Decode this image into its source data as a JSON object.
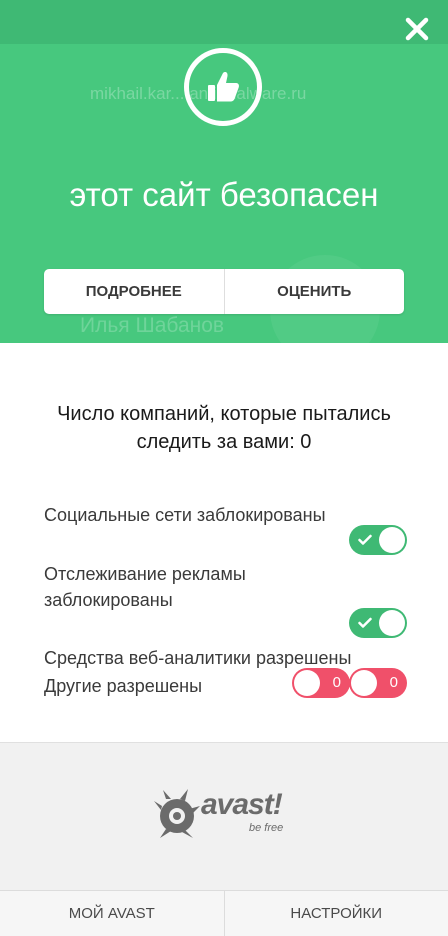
{
  "header": {
    "background_url_text": "mikhail.kar... anti-malware.ru",
    "background_name_text": "Илья Шабанов",
    "status_title": "этот сайт безопасен",
    "details_button": "ПОДРОБНЕЕ",
    "rate_button": "ОЦЕНИТЬ"
  },
  "tracking": {
    "title": "Число компаний, которые пытались следить за вами: 0",
    "items": [
      {
        "label": "Социальные сети заблокированы",
        "state": "on"
      },
      {
        "label": "Отслеживание рекламы заблокированы",
        "state": "on"
      },
      {
        "label": "Средства веб-аналитики разрешены",
        "state": "off",
        "count": "0"
      },
      {
        "label": "Другие разрешены",
        "state": "off",
        "count": "0"
      }
    ]
  },
  "brand": {
    "name": "avast!",
    "tagline": "be free"
  },
  "bottom_nav": {
    "my_avast": "МОЙ AVAST",
    "settings": "НАСТРОЙКИ"
  },
  "colors": {
    "safe_green": "#47c87e",
    "toggle_on": "#3fb974",
    "toggle_off": "#f0506a"
  }
}
